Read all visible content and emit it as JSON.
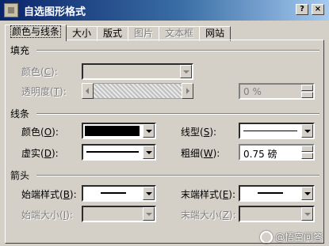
{
  "window": {
    "title": "自选图形格式",
    "help": "?",
    "close": "×"
  },
  "tabs": [
    {
      "label": "颜色与线条"
    },
    {
      "label": "大小"
    },
    {
      "label": "版式"
    },
    {
      "label": "图片"
    },
    {
      "label": "文本框"
    },
    {
      "label": "网站"
    }
  ],
  "fill": {
    "heading": "填充",
    "color_label": "颜色(",
    "color_key": "C",
    "transparency_label": "透明度(",
    "transparency_key": "T",
    "transparency_value": "0 %",
    "close_paren": "):"
  },
  "line": {
    "heading": "线条",
    "color_label": "颜色(",
    "color_key": "O",
    "dash_label": "虚实(",
    "dash_key": "D",
    "style_label": "线型(",
    "style_key": "S",
    "weight_label": "粗细(",
    "weight_key": "W",
    "weight_value": "0.75 磅",
    "close_paren": "):",
    "color_value": "#000000"
  },
  "arrows": {
    "heading": "箭头",
    "begin_style_label": "始端样式(",
    "begin_style_key": "B",
    "end_style_label": "末端样式(",
    "end_style_key": "E",
    "begin_size_label": "始端大小(",
    "begin_size_key": "I",
    "end_size_label": "末端大小(",
    "end_size_key": "Z",
    "close_paren": "):"
  },
  "watermark": {
    "text": "@悟空问答"
  }
}
